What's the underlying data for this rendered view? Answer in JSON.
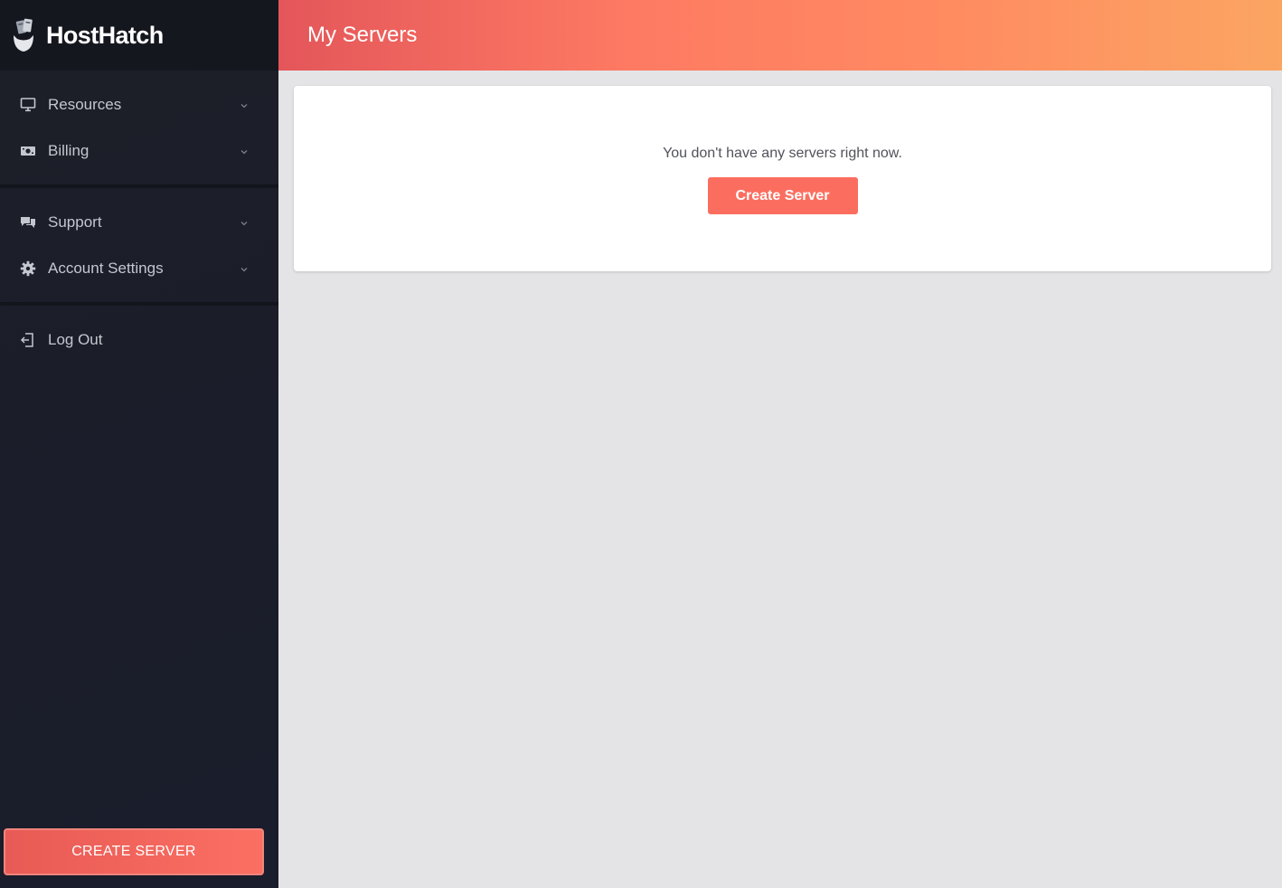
{
  "brand": {
    "name": "HostHatch"
  },
  "header": {
    "title": "My Servers"
  },
  "sidebar": {
    "groups": [
      {
        "items": [
          {
            "label": "Resources",
            "icon": "monitor-icon",
            "expandable": true
          },
          {
            "label": "Billing",
            "icon": "money-icon",
            "expandable": true
          }
        ]
      },
      {
        "items": [
          {
            "label": "Support",
            "icon": "chat-icon",
            "expandable": true
          },
          {
            "label": "Account Settings",
            "icon": "gear-icon",
            "expandable": true
          }
        ]
      },
      {
        "items": [
          {
            "label": "Log Out",
            "icon": "logout-icon",
            "expandable": false
          }
        ]
      }
    ],
    "cta_label": "CREATE SERVER"
  },
  "main": {
    "empty_message": "You don't have any servers right now.",
    "create_button_label": "Create Server"
  },
  "colors": {
    "accent": "#fb6e5f",
    "sidebar_bg": "#1c1f28",
    "content_bg": "#e4e4e7"
  }
}
